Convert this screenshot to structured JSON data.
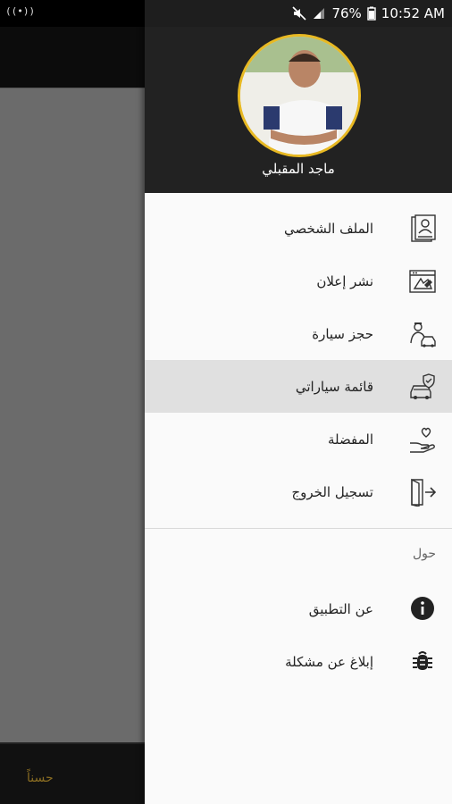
{
  "background_app": {
    "bottom_label": "حسناً",
    "cast_icon": "wifi-signal-icon"
  },
  "status_bar": {
    "battery": "76%",
    "time": "10:52 AM",
    "icons": [
      "mute-icon",
      "signal-icon",
      "battery-icon"
    ]
  },
  "drawer": {
    "user_name": "ماجد المقبلي",
    "items": [
      {
        "label": "الملف الشخصي",
        "icon": "profile-icon"
      },
      {
        "label": "نشر إعلان",
        "icon": "post-ad-icon"
      },
      {
        "label": "حجز سيارة",
        "icon": "book-car-icon"
      },
      {
        "label": "قائمة سياراتي",
        "icon": "my-cars-icon",
        "active": true
      },
      {
        "label": "المفضلة",
        "icon": "favorites-icon"
      },
      {
        "label": "تسجيل الخروج",
        "icon": "logout-icon"
      }
    ],
    "section_title": "حول",
    "about_items": [
      {
        "label": "عن التطبيق",
        "icon": "info-icon"
      },
      {
        "label": "إبلاغ عن مشكلة",
        "icon": "bug-icon"
      }
    ]
  },
  "colors": {
    "header_bg": "#222222",
    "avatar_ring": "#e8b923",
    "active_bg": "#e0e0e0"
  }
}
